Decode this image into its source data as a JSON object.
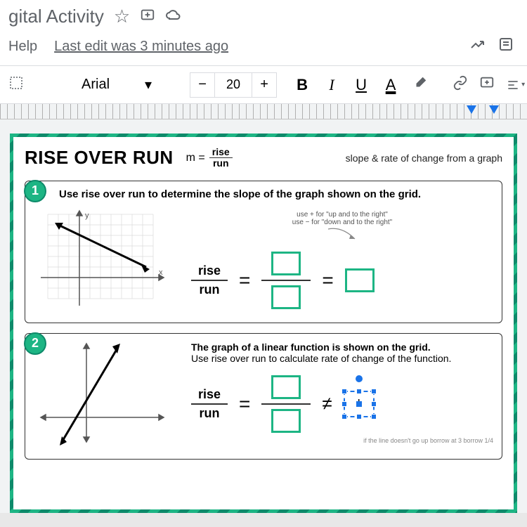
{
  "titlebar": {
    "title_suffix": "gital Activity"
  },
  "menubar": {
    "help": "Help",
    "last_edit": "Last edit was 3 minutes ago"
  },
  "toolbar": {
    "font_family": "Arial",
    "font_size": "20",
    "minus": "−",
    "plus": "+",
    "bold": "B",
    "italic": "I",
    "underline": "U",
    "text_color": "A"
  },
  "worksheet": {
    "title": "RISE OVER RUN",
    "formula_m": "m =",
    "formula_num": "rise",
    "formula_den": "run",
    "subtitle": "slope & rate of change from a graph",
    "problem1": {
      "num": "1",
      "text": "Use rise over run to determine the slope of the graph shown on the grid.",
      "hint1": "use + for \"up and to the right\"",
      "hint2": "use − for \"down and to the right\"",
      "rise": "rise",
      "run": "run",
      "eq": "=",
      "eq2": "="
    },
    "problem2": {
      "num": "2",
      "text1": "The graph of a linear function is shown on the grid.",
      "text2": "Use rise over run to calculate rate of change of the function.",
      "rise": "rise",
      "run": "run",
      "eq": "=",
      "neq": "≠",
      "cursor": "I",
      "footer": "if the line doesn't go up borrow at 3 borrow 1/4"
    }
  }
}
